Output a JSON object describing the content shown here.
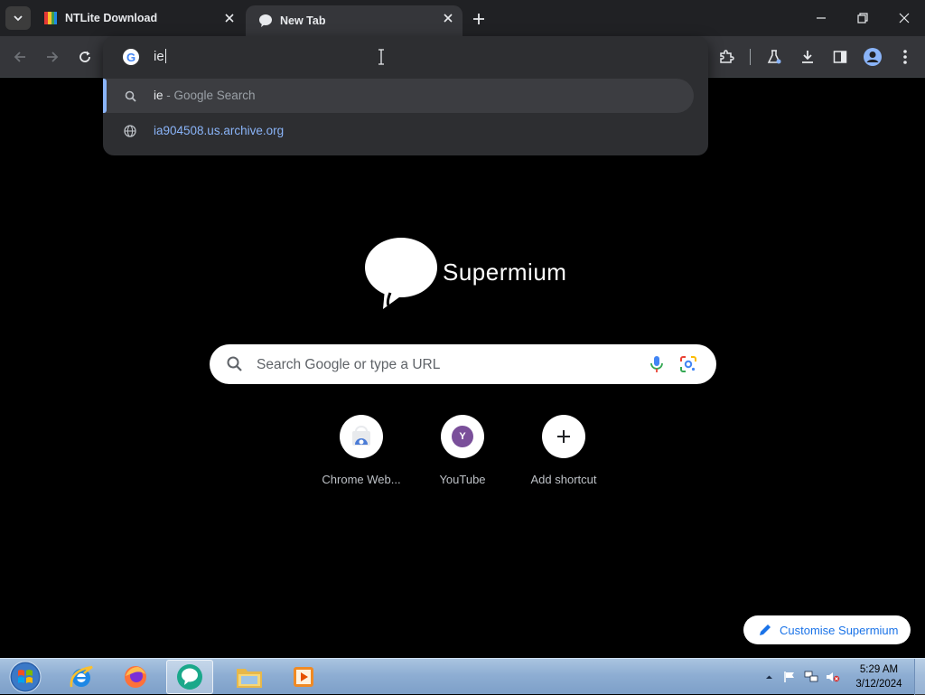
{
  "tabs": [
    {
      "title": "NTLite Download",
      "favicon": "ntlite-icon",
      "active": false
    },
    {
      "title": "New Tab",
      "favicon": "supermium-icon",
      "active": true
    }
  ],
  "omnibox": {
    "input_value": "ie",
    "suggestions": [
      {
        "icon": "search-icon",
        "match": "ie",
        "description": " - Google Search",
        "selected": true
      },
      {
        "icon": "globe-icon",
        "match": "i",
        "rest": "a904508.us.archive.org",
        "selected": false
      }
    ]
  },
  "ntp": {
    "brand": "Supermium",
    "search_placeholder": "Search Google or type a URL",
    "shortcuts": [
      {
        "label": "Chrome Web...",
        "icon": "chrome-web-store-icon"
      },
      {
        "label": "YouTube",
        "icon": "youtube-avatar",
        "avatar_letter": "Y"
      },
      {
        "label": "Add shortcut",
        "icon": "plus-icon"
      }
    ],
    "customise_label": "Customise Supermium"
  },
  "taskbar": {
    "pinned": [
      "start-orb",
      "internet-explorer-icon",
      "firefox-icon",
      "supermium-icon",
      "file-explorer-icon",
      "media-player-icon"
    ],
    "clock_time": "5:29 AM",
    "clock_date": "3/12/2024"
  },
  "colors": {
    "tabstrip_bg": "#202124",
    "toolbar_bg": "#35363a",
    "accent": "#8ab4f8",
    "page_bg": "#000000"
  }
}
